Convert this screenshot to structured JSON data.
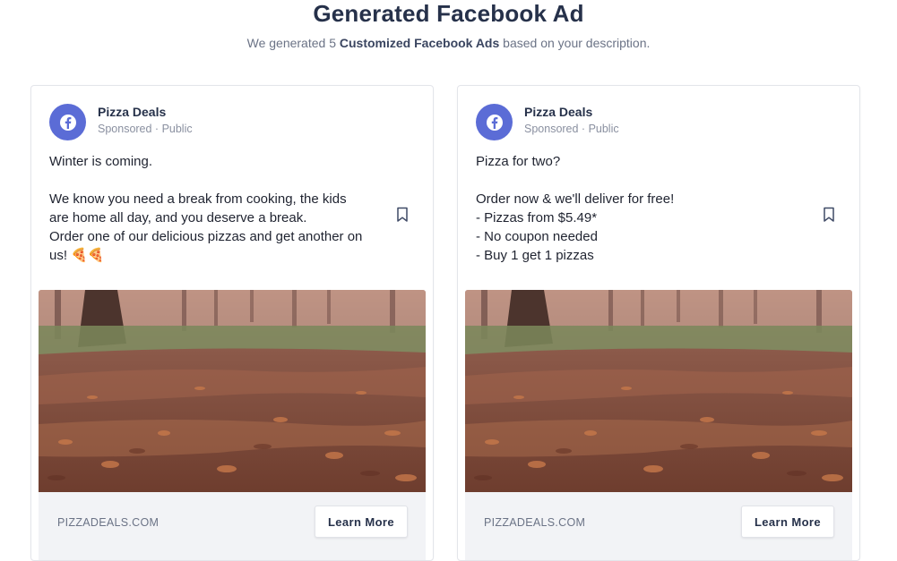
{
  "header": {
    "title": "Generated Facebook Ad",
    "subtitle_prefix": "We generated 5 ",
    "subtitle_highlight": "Customized Facebook Ads",
    "subtitle_suffix": " based on your description."
  },
  "ads": [
    {
      "page_name": "Pizza Deals",
      "meta": "Sponsored · Public",
      "text": "Winter is coming.\n\nWe know you need a break from cooking, the kids are home all day, and you deserve a break.\nOrder one of our delicious pizzas and get another on us! 🍕🍕",
      "image_icon": "autumn-leaves-path-photo",
      "domain": "PIZZADEALS.COM",
      "cta_label": "Learn More"
    },
    {
      "page_name": "Pizza Deals",
      "meta": "Sponsored · Public",
      "text": "Pizza for two?\n\nOrder now & we'll deliver for free!\n- Pizzas from $5.49*\n- No coupon needed\n- Buy 1 get 1 pizzas",
      "image_icon": "autumn-leaves-path-photo",
      "domain": "PIZZADEALS.COM",
      "cta_label": "Learn More"
    }
  ],
  "colors": {
    "accent": "#5b6cd6",
    "title": "#26314a",
    "muted": "#6b7386"
  }
}
